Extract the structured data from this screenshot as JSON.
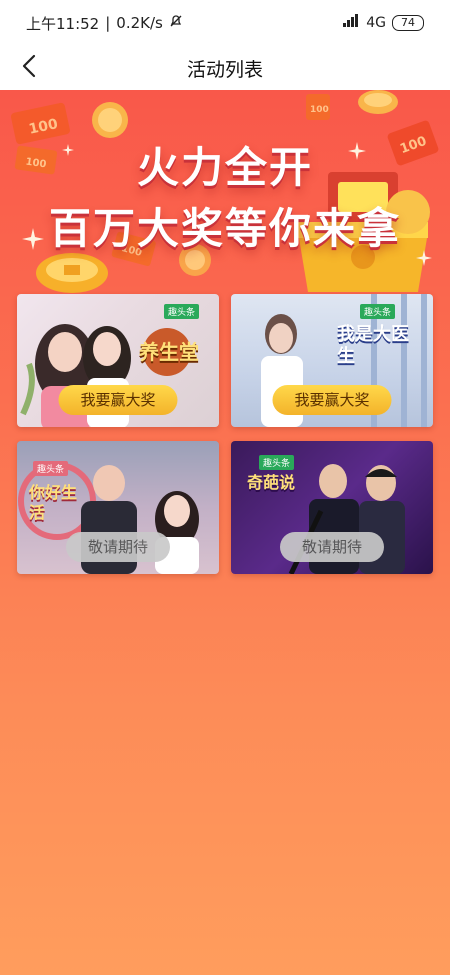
{
  "status_bar": {
    "time": "上午11:52",
    "separator": "|",
    "speed": "0.2K/s",
    "network": "4G",
    "battery": "74",
    "icons": [
      "mute-bell-icon",
      "signal-icon",
      "battery-icon"
    ]
  },
  "nav": {
    "title": "活动列表",
    "back_icon": "chevron-left-icon"
  },
  "hero": {
    "line1": "火力全开",
    "line2": "百万大奖等你来拿"
  },
  "cards": [
    {
      "show": "养生堂",
      "logo": "趣头条",
      "cta": "我要赢大奖",
      "state": "active"
    },
    {
      "show": "我是大医生",
      "logo": "趣头条",
      "cta": "我要赢大奖",
      "state": "active"
    },
    {
      "show": "你好生活",
      "logo": "趣头条",
      "cta": "敬请期待",
      "state": "disabled"
    },
    {
      "show": "奇葩说",
      "logo": "趣头条",
      "cta": "敬请期待",
      "state": "disabled"
    }
  ],
  "colors": {
    "background_top": "#f9584a",
    "background_bottom": "#ff9d5d",
    "cta_active": "#f3c23a",
    "cta_disabled": "#c9c9c9",
    "logo_green": "#2aa95a"
  }
}
